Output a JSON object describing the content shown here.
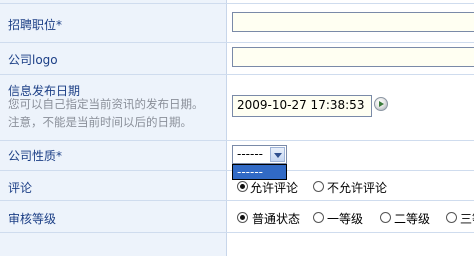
{
  "form": {
    "rows": [
      {
        "label": "招聘职位*"
      },
      {
        "label": "公司logo"
      },
      {
        "label": "信息发布日期",
        "hint_lines": [
          "您可以自己指定当前资讯的发布日期。",
          "注意，不能是当前时间以后的日期。"
        ],
        "value": "2009-10-27 17:38:53"
      },
      {
        "label": "公司性质*",
        "selected": "------",
        "dropdown_option": "------"
      },
      {
        "label": "评论",
        "options": [
          "允许评论",
          "不允许评论"
        ],
        "selected_index": 0
      },
      {
        "label": "审核等级",
        "options": [
          "普通状态",
          "一等级",
          "二等级",
          "三等级"
        ],
        "selected_index": 0
      }
    ]
  }
}
